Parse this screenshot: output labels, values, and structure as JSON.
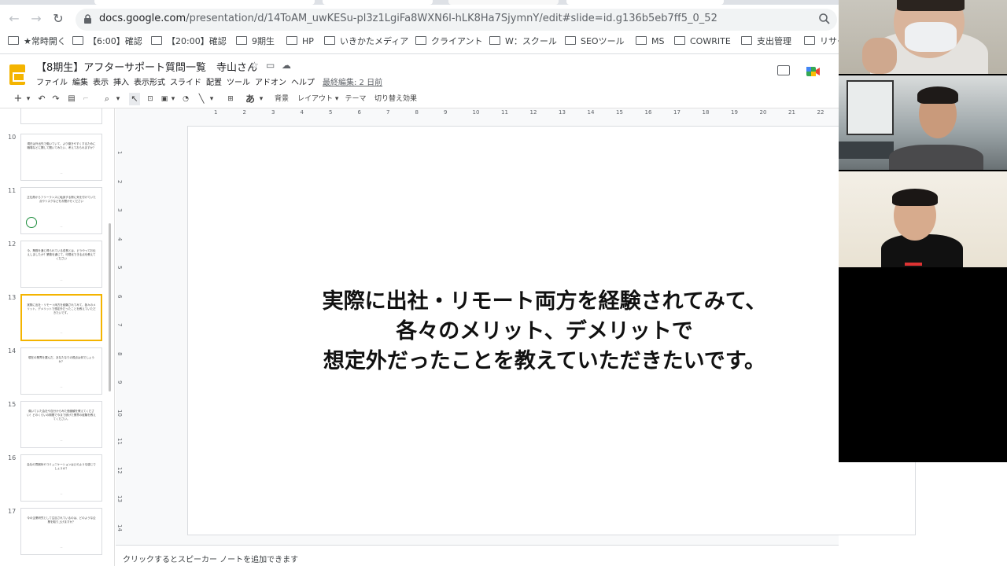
{
  "browser": {
    "url_domain": "docs.google.com",
    "url_path": "/presentation/d/14ToAM_uwKESu-pl3z1LgiFa8WXN6I-hLK8Ha7SjymnY/edit#slide=id.g136b5eb7ff5_0_52",
    "bookmarks": [
      "★常時開く",
      "【6:00】確認",
      "【20:00】確認",
      "9期生",
      "HP",
      "いきかたメディア",
      "クライアント",
      "W：スクール",
      "SEOツール",
      "MS",
      "COWRITE",
      "支出管理",
      "リサー"
    ]
  },
  "app": {
    "title": "【8期生】アフターサポート質問一覧　寺山さん",
    "menu": [
      "ファイル",
      "編集",
      "表示",
      "挿入",
      "表示形式",
      "スライド",
      "配置",
      "ツール",
      "アドオン",
      "ヘルプ"
    ],
    "last_edit": "最終編集: 2 日前"
  },
  "toolbar": {
    "add": "+",
    "zoom": "⌕",
    "ime": "あ",
    "background": "背景",
    "layout": "レイアウト",
    "theme": "テーマ",
    "transition": "切り替え効果"
  },
  "ruler": {
    "h_ticks": [
      "1",
      "2",
      "3",
      "4",
      "5",
      "6",
      "7",
      "8",
      "9",
      "10",
      "11",
      "12",
      "13",
      "14",
      "15",
      "16",
      "17",
      "18",
      "19",
      "20",
      "21",
      "22"
    ],
    "v_ticks": [
      "1",
      "2",
      "3",
      "4",
      "5",
      "6",
      "7",
      "8",
      "9",
      "10",
      "11",
      "12",
      "13",
      "14"
    ]
  },
  "filmstrip": [
    {
      "num": "10",
      "text": "現在は外出先で働いていて、より働きやすくするために職場などに関して聞いてみたい、考えておられますか？",
      "active": false
    },
    {
      "num": "11",
      "text": "正社員からフリーランスに転身する際に気を付けていた点やリスクなどをお聞かせください",
      "active": false
    },
    {
      "num": "12",
      "text": "今、業務を通じ得られている成長とは、どうやってお伝えしましたか？業務を通じて、可視化できる点を教えてください",
      "active": false
    },
    {
      "num": "13",
      "text": "実際に出社・リモート両方を経験されてみて、各々のメリット、デメリットで想定外だったことを教えていただきたいです。",
      "active": true
    },
    {
      "num": "14",
      "text": "現在の業界を選んだ、あなたなりの視点は何でしょうか？",
      "active": false
    },
    {
      "num": "15",
      "text": "働いていた会社や自分からみた価値観を教えてください！どのくらいの期間で今まで続けた業界の経験を教えてください。",
      "active": false
    },
    {
      "num": "16",
      "text": "会社の雰囲気やコミュニケーションはどのような感じでしょうか？",
      "active": false
    },
    {
      "num": "17",
      "text": "今の企業研究として注目されているのは、どのような企業を取り上げますか？",
      "active": false
    }
  ],
  "slide": {
    "lines": [
      "実際に出社・リモート両方を経験されてみて、",
      "各々のメリット、デメリットで",
      "想定外だったことを教えていただきたいです。"
    ]
  },
  "notes_placeholder": "クリックするとスピーカー ノートを追加できます",
  "colors": {
    "slides_yellow": "#f4b400",
    "active_border": "#f4b400",
    "green": "#1e8e3e"
  }
}
